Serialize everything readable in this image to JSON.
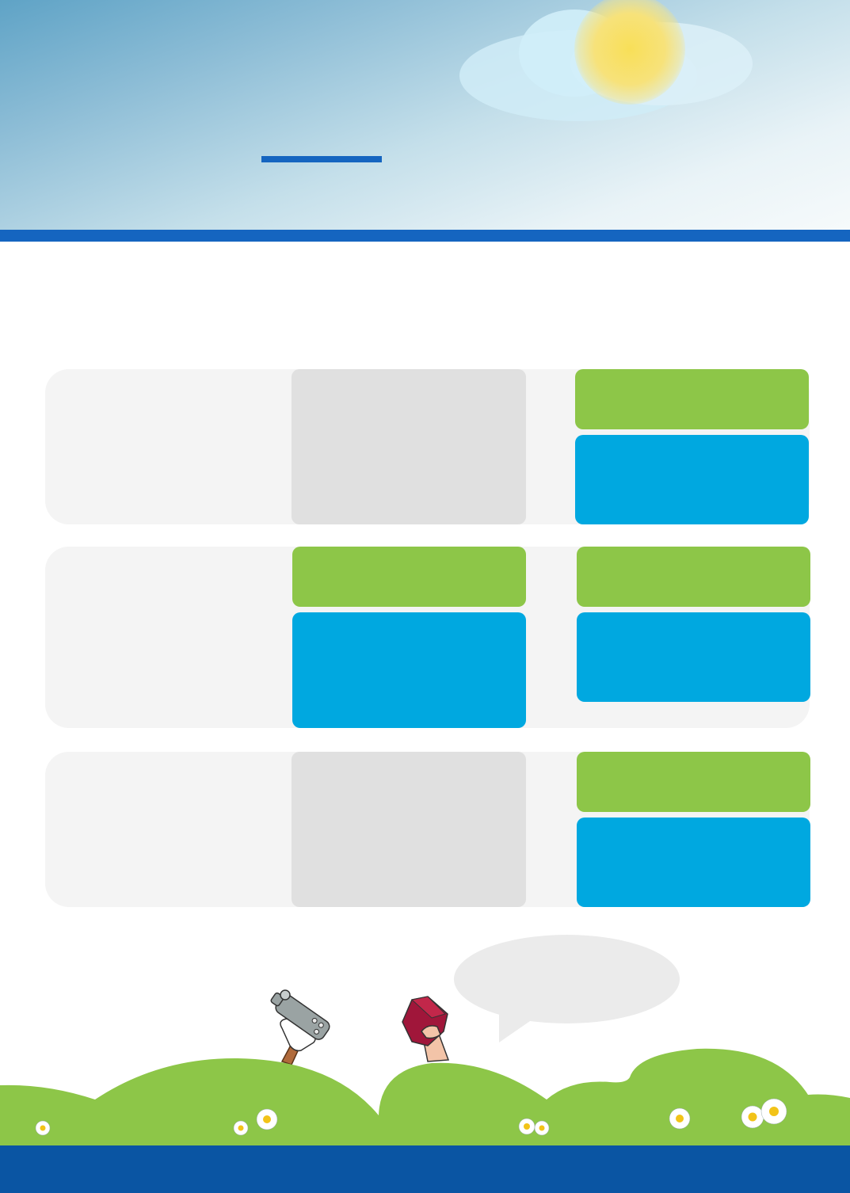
{
  "page": {
    "title": "",
    "subtitle": ""
  },
  "colors": {
    "brand_blue": "#1565c0",
    "footer_blue": "#0a55a3",
    "green": "#8dc648",
    "cyan": "#00a8e0",
    "panel_gray": "#f4f4f4",
    "column_gray": "#e0e0e0",
    "grass": "#8dc648"
  },
  "rows": [
    {
      "label": "",
      "middle": "",
      "right_top": "",
      "right_bottom": ""
    },
    {
      "label": "",
      "middle_top": "",
      "middle_bottom": "",
      "right_top": "",
      "right_bottom": ""
    },
    {
      "label": "",
      "middle": "",
      "right_top": "",
      "right_bottom": ""
    }
  ],
  "speech_bubble": {
    "text": ""
  },
  "illustration": {
    "icons": [
      "sun-icon",
      "cloud-icon",
      "hammer-icon",
      "book-icon",
      "daisy-icon"
    ]
  },
  "footer": {
    "text": ""
  }
}
